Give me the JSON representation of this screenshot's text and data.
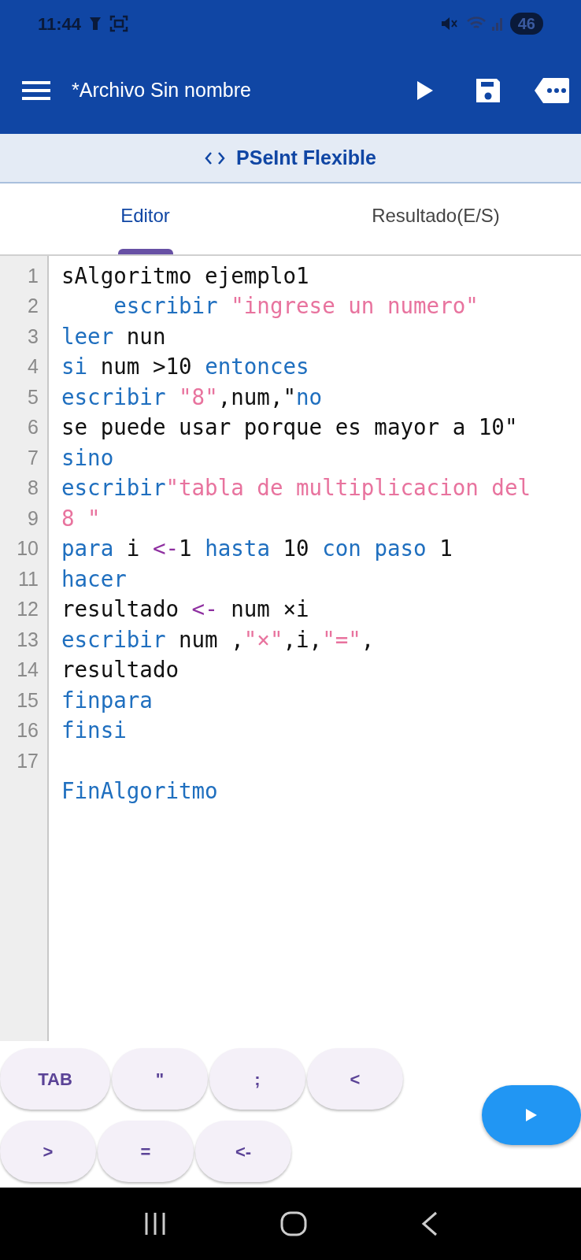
{
  "status_bar": {
    "time": "11:44",
    "battery": "46"
  },
  "app_bar": {
    "title": "*Archivo Sin nombre"
  },
  "mode_bar": {
    "label": "PSeInt Flexible"
  },
  "tabs": [
    {
      "label": "Editor",
      "selected": true
    },
    {
      "label": "Resultado(E/S)",
      "selected": false
    }
  ],
  "editor": {
    "lines": [
      {
        "number": "1",
        "tokens": [
          {
            "kind": "plain",
            "text": "sAlgoritmo ejemplo1"
          }
        ]
      },
      {
        "number": "2",
        "tokens": [
          {
            "kind": "keyword",
            "text": "    escribir "
          },
          {
            "kind": "string",
            "text": "\"ingrese un numero\""
          }
        ]
      },
      {
        "number": "3",
        "tokens": [
          {
            "kind": "keyword",
            "text": "leer"
          },
          {
            "kind": "plain",
            "text": " nun"
          }
        ]
      },
      {
        "number": "4",
        "tokens": [
          {
            "kind": "keyword",
            "text": "si"
          },
          {
            "kind": "plain",
            "text": " num >10 "
          },
          {
            "kind": "keyword",
            "text": "entonces"
          }
        ]
      },
      {
        "number": "5",
        "tokens": [
          {
            "kind": "keyword",
            "text": "escribir "
          },
          {
            "kind": "string",
            "text": "\"8\""
          },
          {
            "kind": "plain",
            "text": ",num,\""
          },
          {
            "kind": "keyword",
            "text": "no"
          }
        ]
      },
      {
        "number": "6",
        "tokens": [
          {
            "kind": "plain",
            "text": "se puede usar porque es mayor a 10\""
          }
        ]
      },
      {
        "number": "7",
        "tokens": [
          {
            "kind": "keyword",
            "text": "sino"
          }
        ]
      },
      {
        "number": "8",
        "tokens": [
          {
            "kind": "keyword",
            "text": "escribir"
          },
          {
            "kind": "string",
            "text": "\"tabla de multiplicacion del"
          }
        ]
      },
      {
        "number": "9",
        "tokens": [
          {
            "kind": "string",
            "text": "8 \""
          }
        ]
      },
      {
        "number": "10",
        "tokens": [
          {
            "kind": "keyword",
            "text": "para"
          },
          {
            "kind": "plain",
            "text": " i "
          },
          {
            "kind": "operator",
            "text": "<-"
          },
          {
            "kind": "plain",
            "text": "1 "
          },
          {
            "kind": "keyword",
            "text": "hasta"
          },
          {
            "kind": "plain",
            "text": " 10 "
          },
          {
            "kind": "keyword",
            "text": "con paso"
          },
          {
            "kind": "plain",
            "text": " 1"
          }
        ]
      },
      {
        "number": "11",
        "tokens": [
          {
            "kind": "keyword",
            "text": "hacer"
          }
        ]
      },
      {
        "number": "12",
        "tokens": [
          {
            "kind": "plain",
            "text": "resultado "
          },
          {
            "kind": "operator",
            "text": "<-"
          },
          {
            "kind": "plain",
            "text": " num ×i"
          }
        ]
      },
      {
        "number": "13",
        "tokens": [
          {
            "kind": "keyword",
            "text": "escribir"
          },
          {
            "kind": "plain",
            "text": " num ,"
          },
          {
            "kind": "string",
            "text": "\"×\""
          },
          {
            "kind": "plain",
            "text": ",i,"
          },
          {
            "kind": "string",
            "text": "\"=\""
          },
          {
            "kind": "plain",
            "text": ","
          }
        ]
      },
      {
        "number": "14",
        "tokens": [
          {
            "kind": "plain",
            "text": "resultado"
          }
        ]
      },
      {
        "number": "15",
        "tokens": [
          {
            "kind": "keyword",
            "text": "finpara"
          }
        ]
      },
      {
        "number": "16",
        "tokens": [
          {
            "kind": "keyword",
            "text": "finsi"
          }
        ]
      },
      {
        "number": "17"
      },
      {
        "tokens": [
          {
            "kind": "keyword",
            "text": "FinAlgoritmo"
          }
        ]
      }
    ]
  },
  "keys": [
    [
      "TAB",
      "\"",
      ";",
      "<"
    ],
    [
      ">",
      "=",
      "<-"
    ]
  ]
}
